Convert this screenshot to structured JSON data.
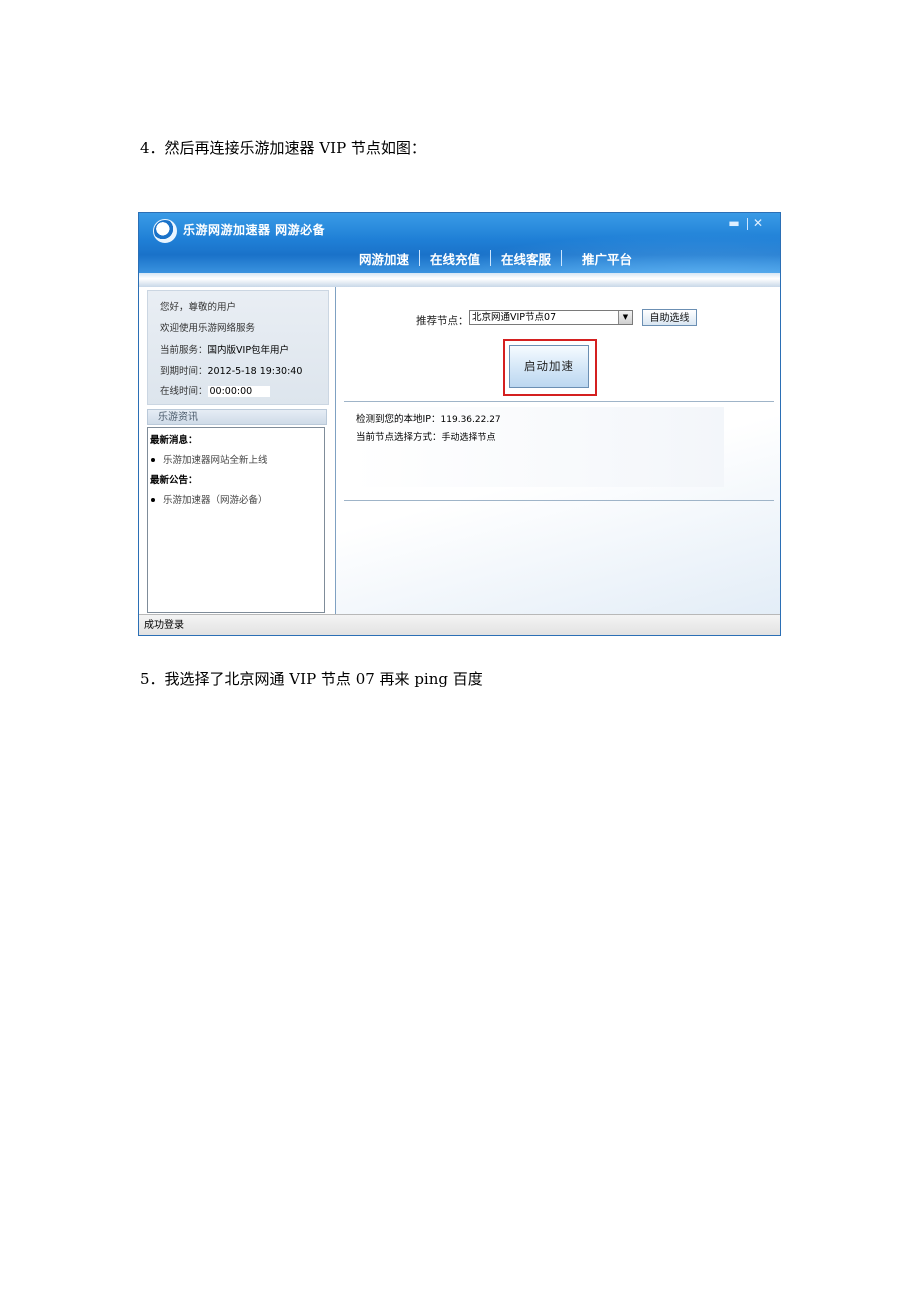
{
  "doc": {
    "step4": "4．然后再连接乐游加速器 VIP 节点如图：",
    "step5": "5．我选择了北京网通 VIP 节点 07 再来 ping 百度"
  },
  "window": {
    "title": "乐游网游加速器  网游必备",
    "minimize_glyph": "▬",
    "close_glyph": "✕",
    "nav": [
      "网游加速",
      "在线充值",
      "在线客服",
      "推广平台"
    ]
  },
  "user_panel": {
    "greeting": "您好，尊敬的用户",
    "welcome": "欢迎使用乐游网络服务",
    "service_label": "当前服务：",
    "service_value": "国内版VIP包年用户",
    "expire_label": "到期时间：",
    "expire_value": "2012-5-18 19:30:40",
    "online_label": "在线时间：",
    "online_value": "00:00:00"
  },
  "news": {
    "header": "乐游资讯",
    "latest_msg_label": "最新消息：",
    "latest_msg_item": "乐游加速器网站全新上线",
    "latest_notice_label": "最新公告：",
    "latest_notice_item": "乐游加速器（网游必备）"
  },
  "accelerate": {
    "node_label": "推荐节点：",
    "node_value": "北京网通VIP节点07",
    "dropdown_glyph": "▼",
    "auto_button": "自助选线",
    "start_button": "启动加速",
    "local_ip_label": "检测到您的本地IP：",
    "local_ip_value": "119.36.22.27",
    "mode_label": "当前节点选择方式：",
    "mode_value": "手动选择节点"
  },
  "status": {
    "text": "成功登录"
  },
  "colors": {
    "titlebar": "#1f7fd6",
    "highlight": "#d42020"
  }
}
